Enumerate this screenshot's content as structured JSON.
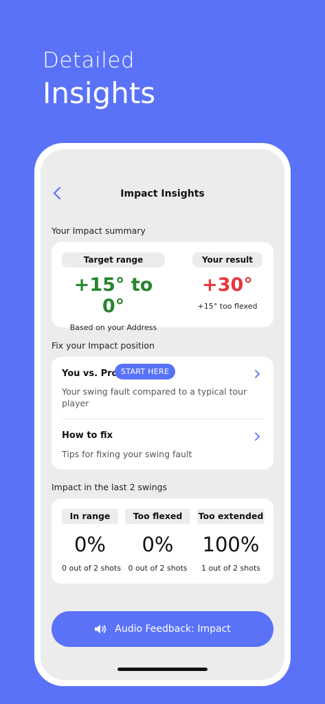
{
  "promo": {
    "line1": "Detailed",
    "line2": "Insights"
  },
  "nav": {
    "title": "Impact Insights",
    "back_icon": "chevron-left-icon"
  },
  "summary": {
    "section_label": "Your Impact summary",
    "target": {
      "label": "Target range",
      "value": "+15° to 0°",
      "note": "Based on your Address",
      "color": "#27852E"
    },
    "result": {
      "label": "Your result",
      "value": "+30°",
      "note": "+15° too flexed",
      "color": "#E8363C"
    }
  },
  "fix": {
    "section_label": "Fix your Impact position",
    "rows": [
      {
        "title": "You vs. Pro",
        "badge": "START HERE",
        "desc": "Your swing fault compared to a typical tour player"
      },
      {
        "title": "How to fix",
        "desc": "Tips for fixing your swing fault"
      }
    ]
  },
  "stats": {
    "section_label": "Impact in the last 2 swings",
    "items": [
      {
        "label": "In range",
        "value": "0%",
        "sub": "0 out of 2 shots"
      },
      {
        "label": "Too flexed",
        "value": "0%",
        "sub": "0 out of 2 shots"
      },
      {
        "label": "Too extended",
        "value": "100%",
        "sub": "1 out of 2 shots"
      }
    ]
  },
  "cta": {
    "label": "Audio Feedback: Impact",
    "icon": "speaker-icon"
  },
  "colors": {
    "accent": "#5A72F8",
    "background": "#ECECEC"
  }
}
